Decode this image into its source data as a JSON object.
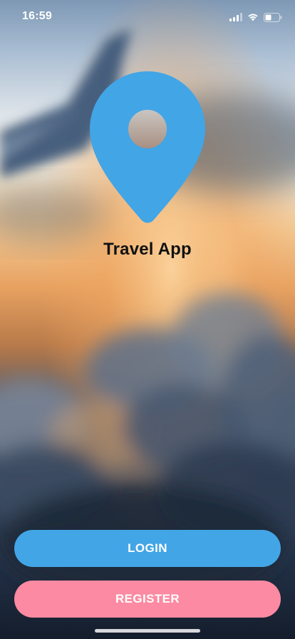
{
  "status_bar": {
    "time": "16:59",
    "icons": [
      "cellular-signal-icon",
      "wifi-icon",
      "battery-icon"
    ]
  },
  "logo": {
    "icon": "location-pin-icon",
    "color": "#42a5e6"
  },
  "app": {
    "title": "Travel App"
  },
  "actions": {
    "login_label": "LOGIN",
    "register_label": "REGISTER"
  },
  "colors": {
    "login_button": "#42a5e6",
    "register_button": "#fb8aa2",
    "title_text": "#111111"
  },
  "background": {
    "description_icon": "airplane-wing-sunset-image"
  }
}
